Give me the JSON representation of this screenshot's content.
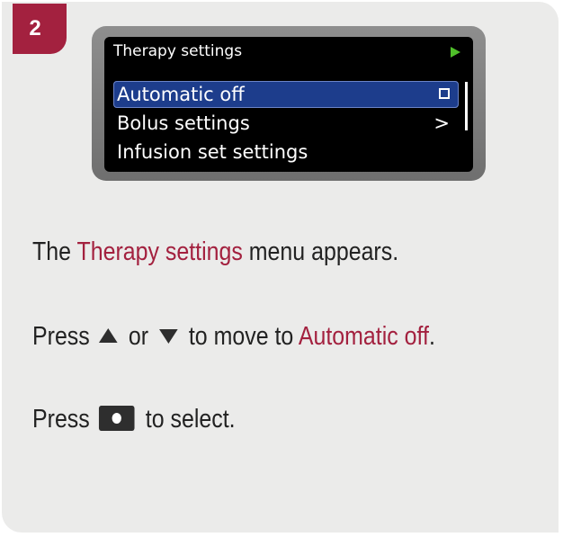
{
  "step": {
    "number": "2"
  },
  "screen": {
    "title": "Therapy settings",
    "menu": [
      {
        "label": "Automatic off",
        "selected": true,
        "indicator": "checkbox-icon"
      },
      {
        "label": "Bolus settings",
        "selected": false,
        "indicator": "chevron-right-icon"
      },
      {
        "label": "Infusion set settings",
        "selected": false,
        "indicator": ""
      }
    ]
  },
  "instructions": {
    "line1": {
      "prefix": "The ",
      "highlight": "Therapy settings",
      "suffix": " menu appears."
    },
    "line2": {
      "prefix": "Press ",
      "middle": " or ",
      "to": " to move to ",
      "highlight": "Automatic off",
      "suffix": "."
    },
    "line3": {
      "prefix": "Press ",
      "suffix": " to select."
    }
  },
  "colors": {
    "accent": "#a3213f",
    "screen_highlight": "#1d3d8c",
    "status_green": "#4fbf2a"
  }
}
